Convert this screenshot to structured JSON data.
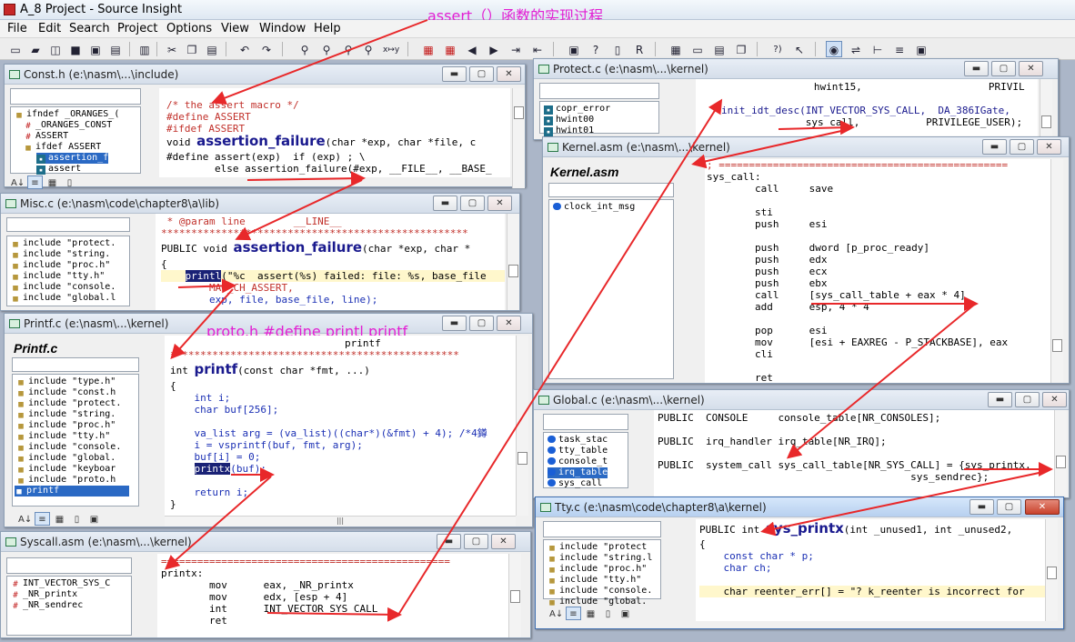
{
  "app": {
    "title": "A_8 Project - Source Insight"
  },
  "annotations": {
    "top": "assert（）函数的实现过程",
    "proto": "proto.h #define printl printf"
  },
  "menu": [
    "File",
    "Edit",
    "Search",
    "Project",
    "Options",
    "View",
    "Window",
    "Help"
  ],
  "colors": {
    "annotation": "#e21fd3",
    "arrow": "#e8282a",
    "keyword": "#1a2fb4",
    "comment": "#c1302a",
    "selection": "#2a69c4"
  },
  "windows": {
    "const": {
      "title": "Const.h (e:\\nasm\\...\\include)",
      "symbols": [
        "ifndef _ORANGES_(",
        "_ORANGES_CONST",
        "ASSERT",
        "ifdef ASSERT",
        "assertion_f",
        "assert"
      ],
      "code": [
        "/* the assert macro */",
        "#define ASSERT",
        "#ifdef ASSERT",
        "void assertion_failure(char *exp, char *file, c",
        "#define assert(exp)  if (exp) ; \\",
        "        else assertion_failure(#exp, __FILE__, __BASE_"
      ]
    },
    "misc": {
      "title": "Misc.c (e:\\nasm\\code\\chapter8\\a\\lib)",
      "symbols": [
        "include \"protect.",
        "include \"string.",
        "include \"proc.h\"",
        "include \"tty.h\"",
        "include \"console.",
        "include \"global.l"
      ],
      "code": [
        " * @param line        __LINE__",
        "***************************************************",
        "PUBLIC void assertion_failure(char *exp, char *",
        "{",
        "    printl(\"%c  assert(%s) failed: file: %s, base_file",
        "        MAG_CH_ASSERT,",
        "        exp, file, base_file, line);"
      ]
    },
    "printf": {
      "title": "Printf.c (e:\\nasm\\...\\kernel)",
      "symtitle": "Printf.c",
      "symbols": [
        "include \"type.h\"",
        "include \"const.h",
        "include \"protect.",
        "include \"string.",
        "include \"proc.h\"",
        "include \"tty.h\"",
        "include \"console.",
        "include \"global.",
        "include \"keyboar",
        "include \"proto.h",
        "printf"
      ],
      "code": [
        "                             printf",
        "************************************************",
        "int printf(const char *fmt, ...)",
        "{",
        "    int i;",
        "    char buf[256];",
        "",
        "    va_list arg = (va_list)((char*)(&fmt) + 4); /*4鐏",
        "    i = vsprintf(buf, fmt, arg);",
        "    buf[i] = 0;",
        "    printx(buf);",
        "",
        "    return i;",
        "}"
      ]
    },
    "syscall": {
      "title": "Syscall.asm (e:\\nasm\\...\\kernel)",
      "symbols": [
        "INT_VECTOR_SYS_C",
        "_NR_printx",
        "_NR_sendrec"
      ],
      "code": [
        "================================================",
        "printx:",
        "        mov      eax, _NR_printx",
        "        mov      edx, [esp + 4]",
        "        int      INT_VECTOR_SYS_CALL",
        "        ret"
      ]
    },
    "protect": {
      "title": "Protect.c (e:\\nasm\\...\\kernel)",
      "symbols": [
        "copr_error",
        "hwint00",
        "hwint01"
      ],
      "code": [
        "                   hwint15,                     PRIVIL",
        "",
        "init_idt_desc(INT_VECTOR_SYS_CALL,  DA_386IGate,",
        "              sys_call,           PRIVILEGE_USER);"
      ]
    },
    "kernel": {
      "title": "Kernel.asm (e:\\nasm\\...\\kernel)",
      "symtitle": "Kernel.asm",
      "symbols": [
        "clock_int_msg"
      ],
      "code": [
        "; ================================================",
        "sys_call:",
        "        call     save",
        "",
        "        sti",
        "        push     esi",
        "",
        "        push     dword [p_proc_ready]",
        "        push     edx",
        "        push     ecx",
        "        push     ebx",
        "        call     [sys_call_table + eax * 4]",
        "        add      esp, 4 * 4",
        "",
        "        pop      esi",
        "        mov      [esi + EAXREG - P_STACKBASE], eax",
        "        cli",
        "",
        "        ret"
      ]
    },
    "global": {
      "title": "Global.c (e:\\nasm\\...\\kernel)",
      "symbols": [
        "task_stac",
        "tty_table",
        "console_t",
        "irq_table",
        "sys_call"
      ],
      "code": [
        "PUBLIC  CONSOLE     console_table[NR_CONSOLES];",
        "",
        "PUBLIC  irq_handler irq_table[NR_IRQ];",
        "",
        "PUBLIC  system_call sys_call_table[NR_SYS_CALL] = {sys_printx,",
        "                                          sys_sendrec};"
      ]
    },
    "tty": {
      "title": "Tty.c (e:\\nasm\\code\\chapter8\\a\\kernel)",
      "symbols": [
        "include \"protect",
        "include \"string.l",
        "include \"proc.h\"",
        "include \"tty.h\"",
        "include \"console.",
        "include \"global."
      ],
      "code": [
        "PUBLIC int sys_printx(int _unused1, int _unused2,",
        "{",
        "    const char * p;",
        "    char ch;",
        "",
        "    char reenter_err[] = \"? k_reenter is incorrect for"
      ]
    }
  }
}
